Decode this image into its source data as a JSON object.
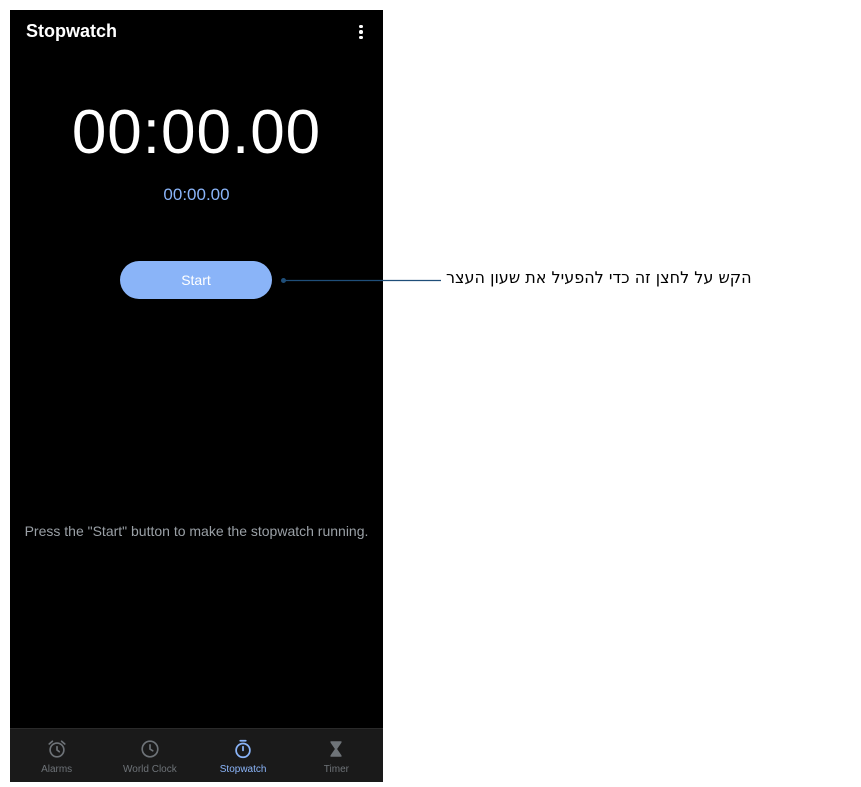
{
  "app": {
    "title": "Stopwatch"
  },
  "stopwatch": {
    "main_time": "00:00.00",
    "lap_time": "00:00.00",
    "start_label": "Start",
    "hint": "Press the \"Start\" button to make the stopwatch running."
  },
  "nav": {
    "items": [
      {
        "label": "Alarms",
        "icon": "alarm-icon",
        "active": false
      },
      {
        "label": "World Clock",
        "icon": "clock-icon",
        "active": false
      },
      {
        "label": "Stopwatch",
        "icon": "stopwatch-icon",
        "active": true
      },
      {
        "label": "Timer",
        "icon": "hourglass-icon",
        "active": false
      }
    ]
  },
  "callout": {
    "text": "הקש על לחצן זה כדי להפעיל את שעון העצר"
  },
  "colors": {
    "background": "#000000",
    "accent": "#8ab4f8",
    "inactive": "#6e7378",
    "callout_line": "#1f4e79"
  }
}
